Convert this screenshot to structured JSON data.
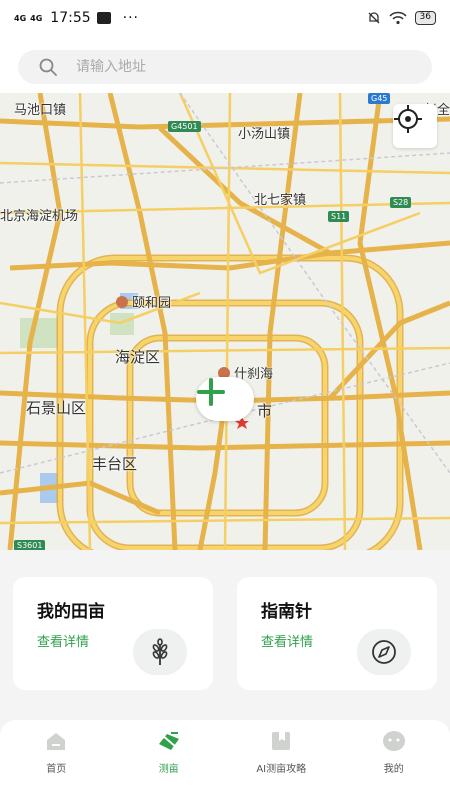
{
  "status_bar": {
    "signal_1": "4G",
    "signal_2": "4G",
    "time": "17:55",
    "more": "···",
    "battery": "36"
  },
  "search": {
    "placeholder": "请输入地址"
  },
  "map": {
    "labels": {
      "machikou": "马池口镇",
      "xiaotangshan": "小汤山镇",
      "beiqijia": "北七家镇",
      "airport": "北京海淀机场",
      "summer_palace": "颐和园",
      "haidian": "海淀区",
      "shichahai": "什刹海",
      "city": "市",
      "shijingshan": "石景山区",
      "fengtai": "丰台区",
      "zhao": "赵全"
    },
    "shields": {
      "g45": "G45",
      "g4501": "G4501",
      "s11": "S11",
      "s28": "S28",
      "s3601": "S3601"
    }
  },
  "cards": [
    {
      "title": "我的田亩",
      "link": "查看详情",
      "icon": "wheat-icon"
    },
    {
      "title": "指南针",
      "link": "查看详情",
      "icon": "compass-icon"
    }
  ],
  "tabs": [
    {
      "label": "首页",
      "icon": "home-icon"
    },
    {
      "label": "测亩",
      "icon": "measure-icon",
      "active": true
    },
    {
      "label": "AI测亩攻略",
      "icon": "bookmark-icon"
    },
    {
      "label": "我的",
      "icon": "profile-icon"
    }
  ],
  "colors": {
    "accent": "#2fa14d",
    "road": "#f4c95a",
    "road_edge": "#e0a93c"
  }
}
